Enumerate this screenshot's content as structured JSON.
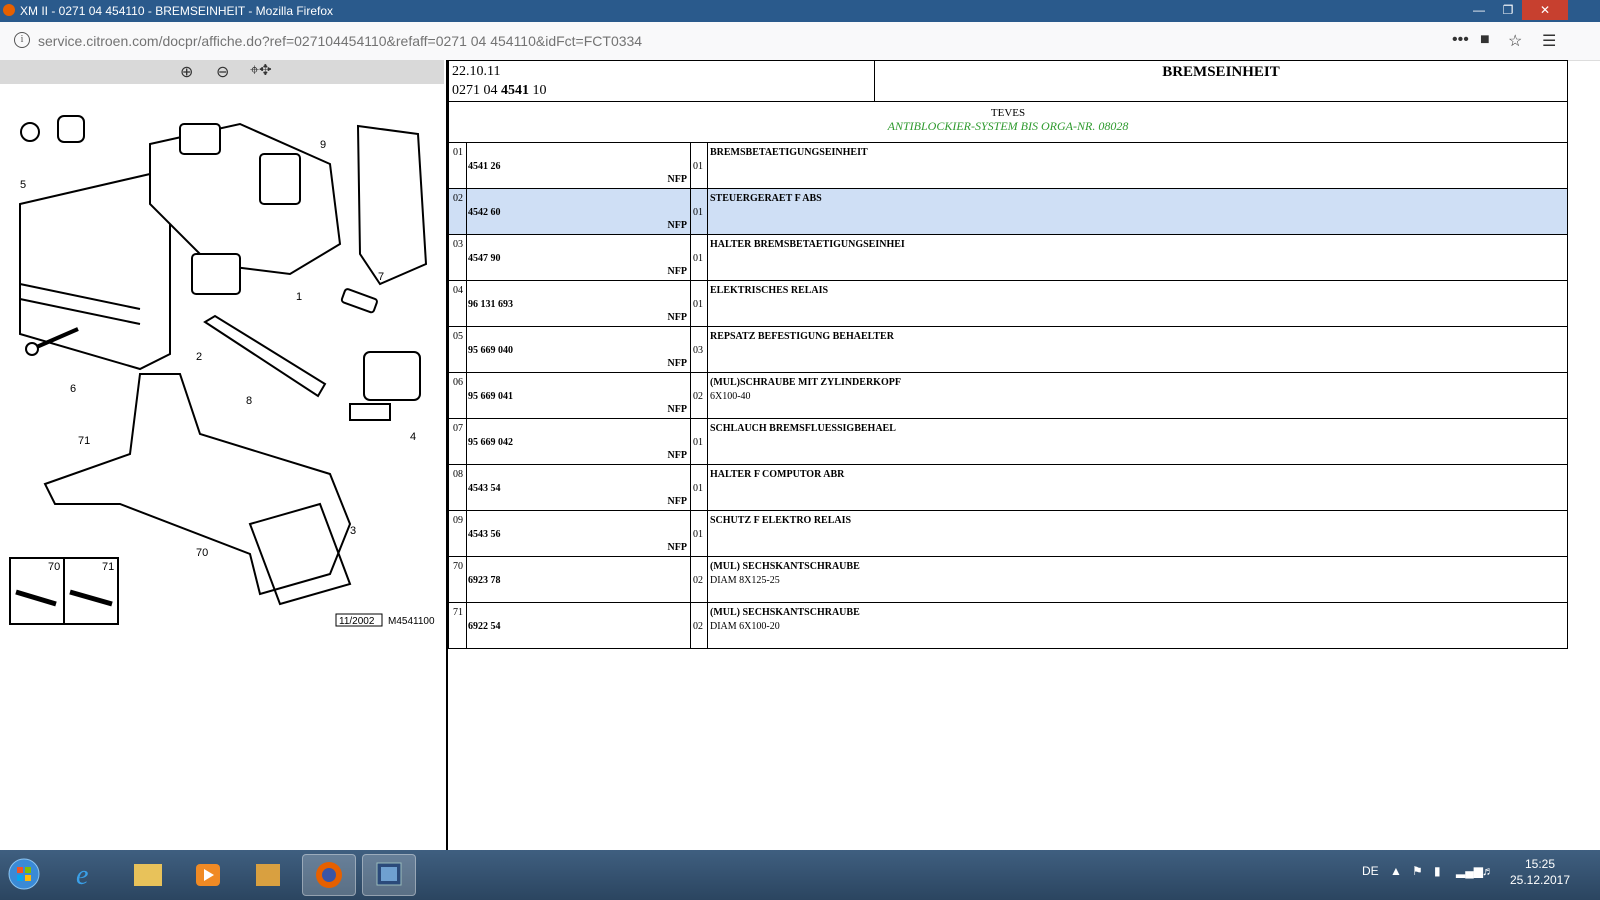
{
  "window": {
    "title": "XM II - 0271 04 454110 - BREMSEINHEIT - Mozilla Firefox"
  },
  "browser": {
    "url": "service.citroen.com/docpr/affiche.do?ref=027104454110&refaff=0271 04 454110&idFct=FCT0334"
  },
  "diagram": {
    "labels": [
      "9",
      "5",
      "7",
      "1",
      "2",
      "6",
      "8",
      "4",
      "71",
      "3",
      "70",
      "70",
      "71"
    ],
    "stamp": "11/2002",
    "code": "M4541100"
  },
  "header": {
    "date": "22.10.11",
    "ref_prefix": "0271 04",
    "ref_bold": "4541",
    "ref_suffix": "10",
    "name": "BREMSEINHEIT",
    "maker": "TEVES",
    "note": "ANTIBLOCKIER-SYSTEM BIS ORGA-NR. 08028"
  },
  "parts": [
    {
      "pos": "01",
      "num": "4541 26",
      "nfp": "NFP",
      "qty": "01",
      "desc": "BREMSBETAETIGUNGSEINHEIT",
      "desc2": ""
    },
    {
      "pos": "02",
      "num": "4542 60",
      "nfp": "NFP",
      "qty": "01",
      "desc": "STEUERGERAET F ABS",
      "desc2": ""
    },
    {
      "pos": "03",
      "num": "4547 90",
      "nfp": "NFP",
      "qty": "01",
      "desc": "HALTER BREMSBETAETIGUNGSEINHEI",
      "desc2": ""
    },
    {
      "pos": "04",
      "num": "96 131 693",
      "nfp": "NFP",
      "qty": "01",
      "desc": "ELEKTRISCHES RELAIS",
      "desc2": ""
    },
    {
      "pos": "05",
      "num": "95 669 040",
      "nfp": "NFP",
      "qty": "03",
      "desc": "REPSATZ BEFESTIGUNG BEHAELTER",
      "desc2": ""
    },
    {
      "pos": "06",
      "num": "95 669 041",
      "nfp": "NFP",
      "qty": "02",
      "desc": "(MUL)SCHRAUBE MIT ZYLINDERKOPF",
      "desc2": "6X100-40"
    },
    {
      "pos": "07",
      "num": "95 669 042",
      "nfp": "NFP",
      "qty": "01",
      "desc": "SCHLAUCH BREMSFLUESSIGBEHAEL",
      "desc2": ""
    },
    {
      "pos": "08",
      "num": "4543 54",
      "nfp": "NFP",
      "qty": "01",
      "desc": "HALTER F COMPUTOR ABR",
      "desc2": ""
    },
    {
      "pos": "09",
      "num": "4543 56",
      "nfp": "NFP",
      "qty": "01",
      "desc": "SCHUTZ F ELEKTRO RELAIS",
      "desc2": ""
    },
    {
      "pos": "70",
      "num": "6923 78",
      "nfp": "",
      "qty": "02",
      "desc": "(MUL) SECHSKANTSCHRAUBE",
      "desc2": "DIAM 8X125-25"
    },
    {
      "pos": "71",
      "num": "6922 54",
      "nfp": "",
      "qty": "02",
      "desc": "(MUL) SECHSKANTSCHRAUBE",
      "desc2": "DIAM 6X100-20"
    }
  ],
  "selected_row": 1,
  "taskbar": {
    "lang": "DE",
    "time": "15:25",
    "date": "25.12.2017"
  },
  "icons": {
    "zoom_in": "zoom-in-icon",
    "zoom_out": "zoom-out-icon",
    "zoom_pan": "zoom-pan-icon"
  },
  "colors": {
    "selected_row": "#cfdff5",
    "note_green": "#2e9a2e"
  }
}
